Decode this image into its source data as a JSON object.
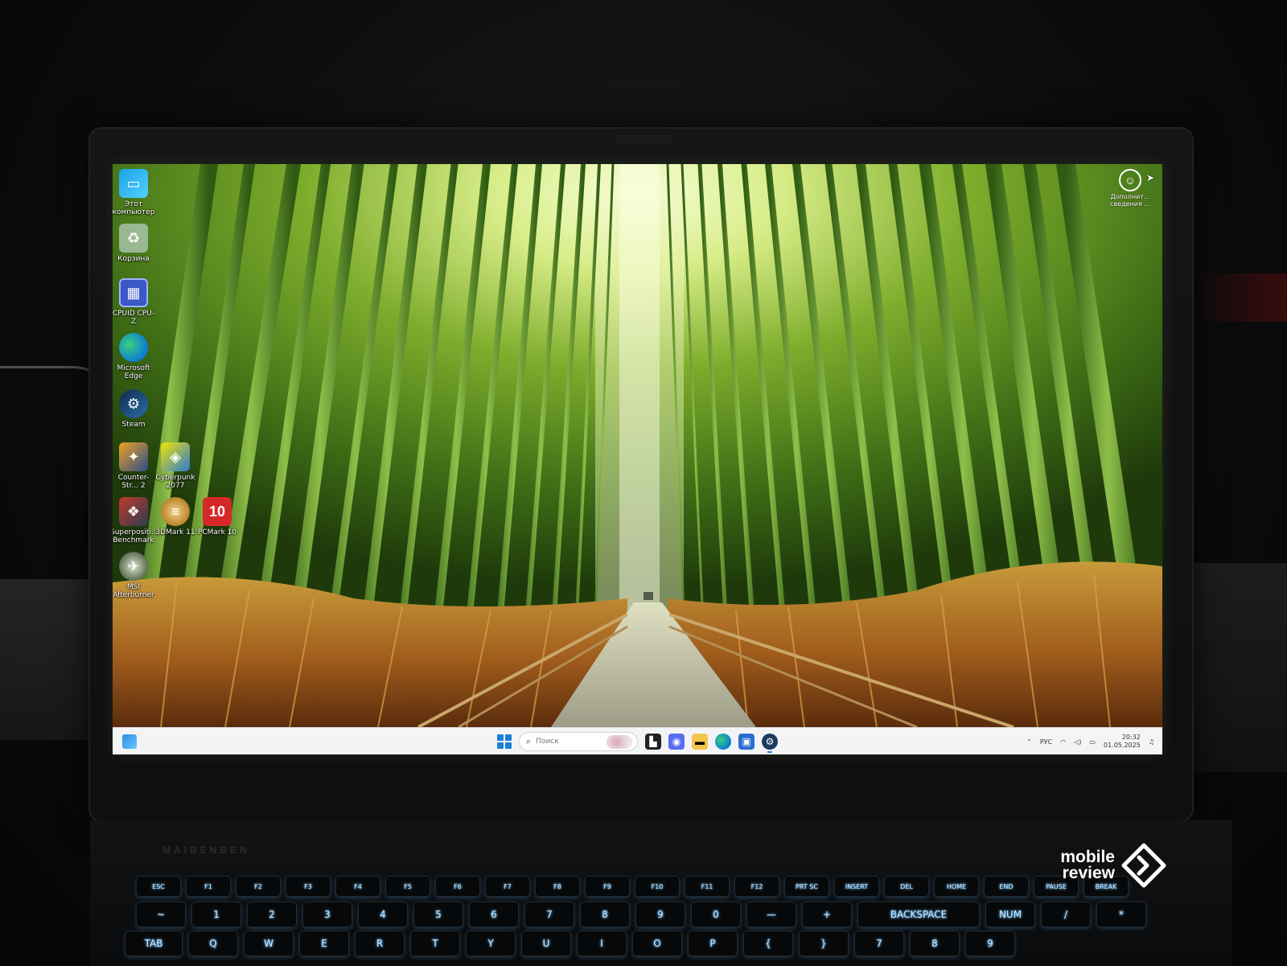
{
  "desktop": {
    "icons": [
      {
        "label": "Этот компьютер"
      },
      {
        "label": "Корзина"
      },
      {
        "label": "CPUID CPU-Z"
      },
      {
        "label": "Microsoft Edge"
      },
      {
        "label": "Steam"
      },
      {
        "label": "Counter-Str... 2"
      },
      {
        "label": "Cyberpunk 2077"
      },
      {
        "label": "Superpositi... Benchmark"
      },
      {
        "label": "3DMark 11"
      },
      {
        "label": "PCMark 10"
      },
      {
        "label": "MSI Afterburner"
      }
    ],
    "widget": {
      "label": "Дополнит... сведения ..."
    }
  },
  "taskbar": {
    "search_placeholder": "Поиск",
    "tray": {
      "language": "РУС",
      "time": "20:32",
      "date": "01.05.2025"
    }
  },
  "keyboard": {
    "fn_row": [
      "ESC",
      "F1",
      "F2",
      "F3",
      "F4",
      "F5",
      "F6",
      "F7",
      "F8",
      "F9",
      "F10",
      "F11",
      "F12",
      "PRT SC",
      "INSERT",
      "DEL",
      "HOME",
      "END",
      "PAUSE",
      "BREAK"
    ],
    "number_row": [
      "~",
      "1",
      "2",
      "3",
      "4",
      "5",
      "6",
      "7",
      "8",
      "9",
      "0",
      "—",
      "+",
      "BACKSPACE",
      "NUM",
      "/",
      "*"
    ],
    "letter_row": [
      "TAB",
      "Q",
      "W",
      "E",
      "R",
      "T",
      "Y",
      "U",
      "I",
      "O",
      "P",
      "{",
      "}",
      "7",
      "8",
      "9"
    ]
  },
  "watermark": {
    "line1": "mobile",
    "line2": "review"
  }
}
